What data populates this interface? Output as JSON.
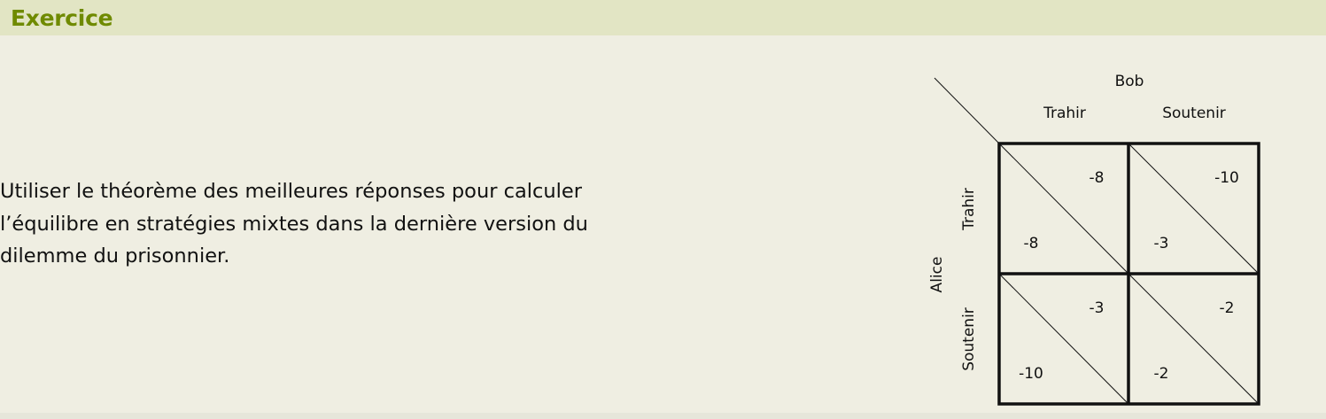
{
  "header": {
    "title": "Exercice"
  },
  "body": {
    "lines": [
      "Utiliser le théorème des meilleures réponses pour calculer",
      "l’équilibre en stratégies mixtes dans la dernière version du",
      "dilemme du prisonnier."
    ]
  },
  "matrix": {
    "column_player": "Bob",
    "row_player": "Alice",
    "columns": [
      "Trahir",
      "Soutenir"
    ],
    "rows": [
      "Trahir",
      "Soutenir"
    ],
    "cells": [
      [
        {
          "alice": "-8",
          "bob": "-8"
        },
        {
          "alice": "-3",
          "bob": "-10"
        }
      ],
      [
        {
          "alice": "-10",
          "bob": "-3"
        },
        {
          "alice": "-2",
          "bob": "-2"
        }
      ]
    ]
  }
}
